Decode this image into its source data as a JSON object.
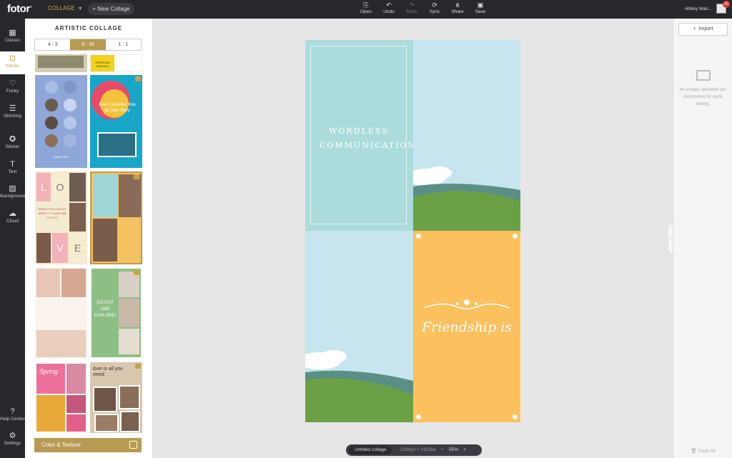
{
  "topbar": {
    "logo": "fotor",
    "mode": "COLLAGE",
    "new_collage": "New Collage",
    "tools": [
      {
        "label": "Open",
        "icon": "open-icon"
      },
      {
        "label": "Undo",
        "icon": "undo-icon"
      },
      {
        "label": "Redo",
        "icon": "redo-icon"
      },
      {
        "label": "Sync",
        "icon": "sync-icon"
      },
      {
        "label": "Share",
        "icon": "share-icon"
      },
      {
        "label": "Save",
        "icon": "save-icon"
      }
    ],
    "user": "Abbey Mari...",
    "badge": "20"
  },
  "rail": [
    {
      "label": "Classic",
      "icon": "grid-icon"
    },
    {
      "label": "Artistic",
      "icon": "artistic-icon"
    },
    {
      "label": "Funky",
      "icon": "heart-frame-icon"
    },
    {
      "label": "Stitching",
      "icon": "stitching-icon"
    },
    {
      "label": "Sticker",
      "icon": "sticker-icon"
    },
    {
      "label": "Text",
      "icon": "text-icon"
    },
    {
      "label": "Background",
      "icon": "background-icon"
    },
    {
      "label": "Cloud",
      "icon": "cloud-icon"
    },
    {
      "label": "Help Center",
      "icon": "help-icon"
    },
    {
      "label": "Settings",
      "icon": "settings-icon"
    }
  ],
  "panel": {
    "title": "ARTISTIC COLLAGE",
    "ratios": [
      "4 : 3",
      "9 : 16",
      "1 : 1"
    ],
    "active_ratio": "9 : 16",
    "color_texture": "Color & Texture"
  },
  "thumb_text": {
    "freedom": "FREEDOM SEASON",
    "rainy": "RAINY DAY",
    "every": "Every Summer Has Its Own Story",
    "love_l": "L",
    "love_o": "O",
    "love_v": "V",
    "love_e": "E",
    "follow": "WHEN I FOLLOW MY HEART, IT LEADS ME TO YOU",
    "goout": "GO OUT AND EXPLORE!",
    "spring": "Spring",
    "loveis": "love is all you need."
  },
  "collage": {
    "text1": "WORDLESS COMMUNICATION",
    "text2": "Friendship is"
  },
  "status": {
    "name": "Untitled collage",
    "size": "1080px × 1920px",
    "zoom": "55%"
  },
  "rpanel": {
    "import": "Import",
    "no_images": "No images uploaded yet. Add photos for quick editing.",
    "clear_all": "Clear All"
  }
}
